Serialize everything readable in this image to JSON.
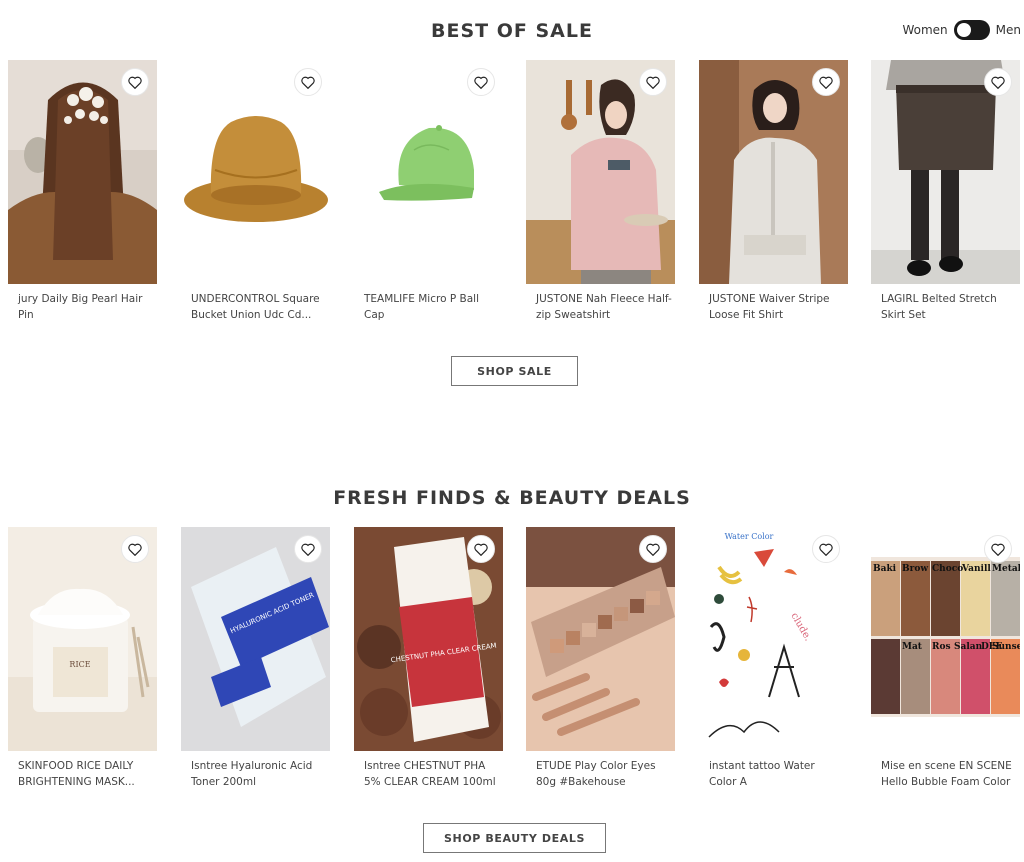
{
  "toggle": {
    "left_label": "Women",
    "right_label": "Men"
  },
  "sections": [
    {
      "title": "BEST OF SALE",
      "button": "SHOP SALE",
      "products": [
        {
          "name": "jury Daily Big Pearl Hair Pin"
        },
        {
          "name": "UNDERCONTROL Square Bucket Union Udc Cd..."
        },
        {
          "name": "TEAMLIFE Micro P Ball Cap"
        },
        {
          "name": "JUSTONE Nah Fleece Half-zip Sweatshirt"
        },
        {
          "name": "JUSTONE Waiver Stripe Loose Fit Shirt"
        },
        {
          "name": "LAGIRL Belted Stretch Skirt Set"
        }
      ]
    },
    {
      "title": "FRESH FINDS & BEAUTY DEALS",
      "button": "SHOP BEAUTY DEALS",
      "products": [
        {
          "name": "SKINFOOD RICE DAILY BRIGHTENING MASK...",
          "image_text": "RICE"
        },
        {
          "name": "Isntree Hyaluronic Acid Toner 200ml",
          "image_text": "HYALURONIC ACID TONER"
        },
        {
          "name": "Isntree CHESTNUT PHA 5% CLEAR CREAM 100ml",
          "image_text": "CHESTNUT PHA CLEAR CREAM"
        },
        {
          "name": "ETUDE Play Color Eyes 80g #Bakehouse"
        },
        {
          "name": "instant tattoo Water Color A",
          "image_text": "Water Color"
        },
        {
          "name": "Mise en scene EN SCENE Hello Bubble Foam Color",
          "image_text": [
            "Baki",
            "Brow",
            "Choco",
            "Vanill",
            "Metalli",
            "Mat",
            "Ros",
            "Salan",
            "DEE",
            "Sunse"
          ]
        }
      ]
    }
  ]
}
